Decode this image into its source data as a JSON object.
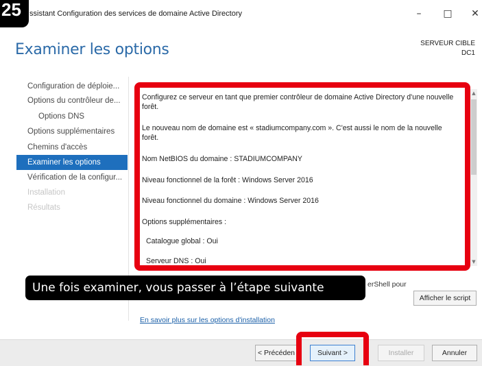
{
  "step_number": "25",
  "window": {
    "title": "ssistant Configuration des services de domaine Active Directory",
    "minimize_symbol": "–",
    "maximize_symbol": "□",
    "close_symbol": "✕"
  },
  "header": {
    "title": "Examiner les options",
    "target_server_label": "SERVEUR CIBLE",
    "target_server_name": "DC1"
  },
  "sidebar": {
    "items": [
      {
        "label": "Configuration de déploie...",
        "state": "normal"
      },
      {
        "label": "Options du contrôleur de...",
        "state": "normal"
      },
      {
        "label": "Options DNS",
        "state": "sub"
      },
      {
        "label": "Options supplémentaires",
        "state": "normal"
      },
      {
        "label": "Chemins d'accès",
        "state": "normal"
      },
      {
        "label": "Examiner les options",
        "state": "active"
      },
      {
        "label": "Vérification de la configur...",
        "state": "normal"
      },
      {
        "label": "Installation",
        "state": "disabled"
      },
      {
        "label": "Résultats",
        "state": "disabled"
      }
    ]
  },
  "review": {
    "lines": [
      "Configurez ce serveur en tant que premier contrôleur de domaine Active Directory d'une nouvelle forêt.",
      "Le nouveau nom de domaine est « stadiumcompany.com ». C'est aussi le nom de la nouvelle forêt.",
      "Nom NetBIOS du domaine : STADIUMCOMPANY",
      "Niveau fonctionnel de la forêt : Windows Server 2016",
      "Niveau fonctionnel du domaine : Windows Server 2016",
      "Options supplémentaires :",
      "Catalogue global : Oui",
      "Serveur DNS : Oui"
    ]
  },
  "powershell_text": "erShell pour",
  "view_script_button": "Afficher le script",
  "caption": "Une fois examiner, vous passer à l’étape suivante",
  "more_link": "En savoir plus sur les options d'installation",
  "footer": {
    "previous_label": "< Précéden",
    "next_label": "Suivant >",
    "install_label": "Installer",
    "cancel_label": "Annuler"
  },
  "colors": {
    "accent": "#1e6fbd",
    "title_blue": "#2b6aa8",
    "highlight_red": "#e70010"
  }
}
